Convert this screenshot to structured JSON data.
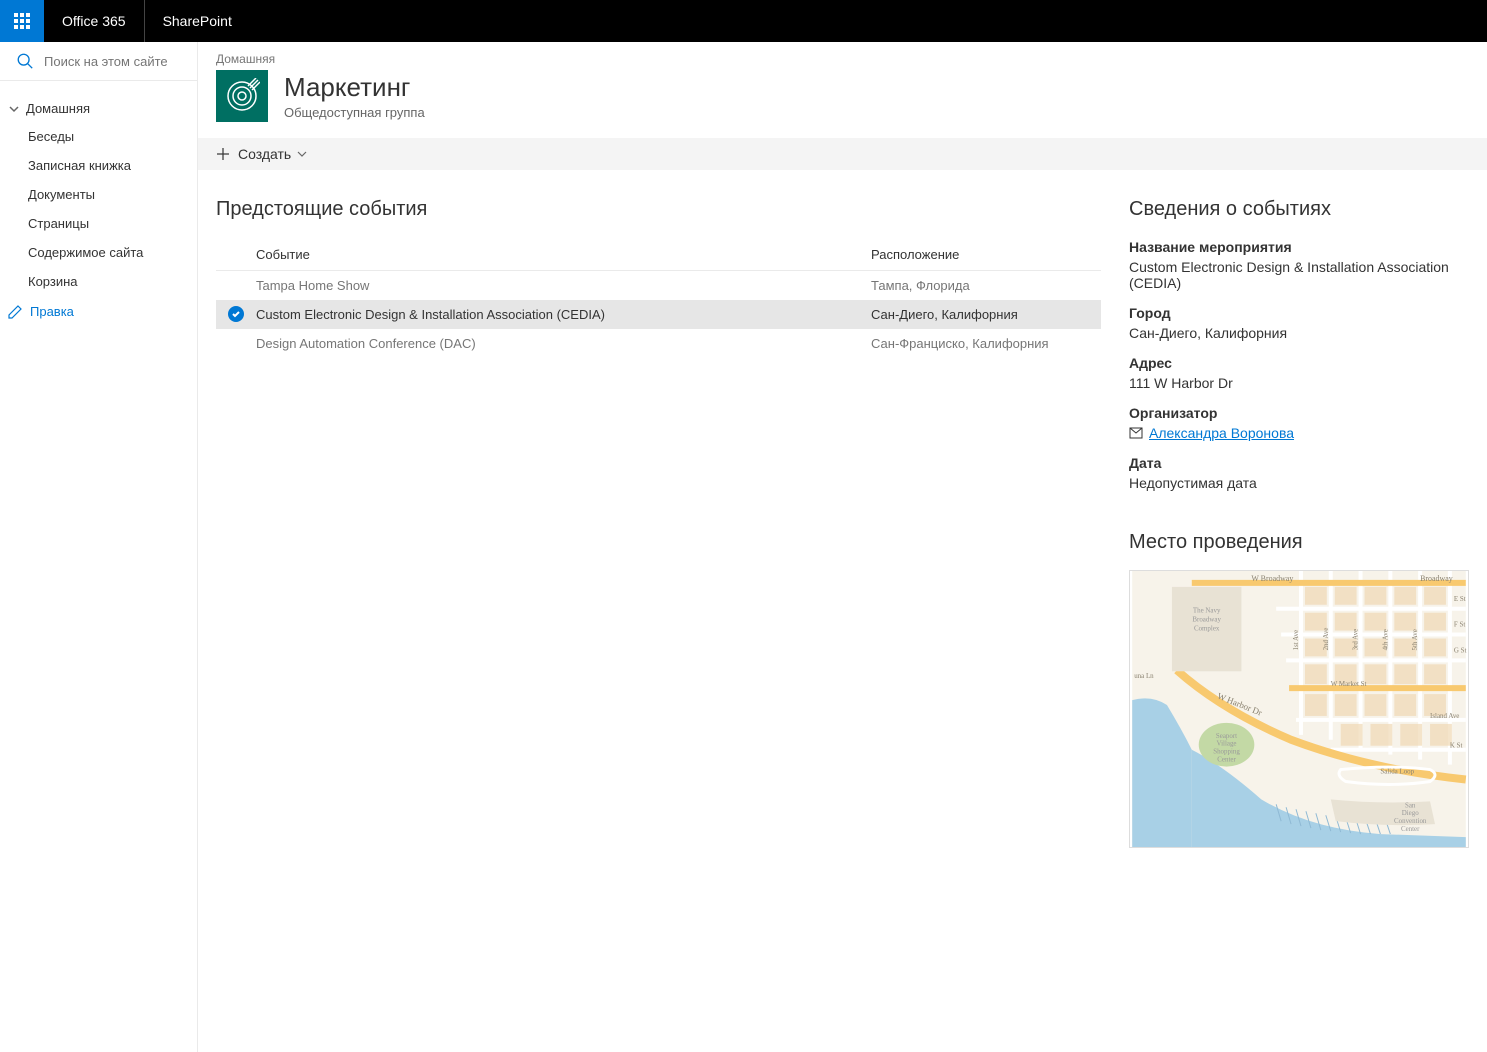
{
  "topbar": {
    "brand": "Office 365",
    "appname": "SharePoint"
  },
  "search": {
    "placeholder": "Поиск на этом сайте"
  },
  "nav": {
    "root": "Домашняя",
    "items": [
      "Беседы",
      "Записная книжка",
      "Документы",
      "Страницы",
      "Содержимое сайта",
      "Корзина"
    ],
    "edit": "Правка"
  },
  "page": {
    "crumb": "Домашняя",
    "title": "Маркетинг",
    "subtitle": "Общедоступная группа"
  },
  "toolbar": {
    "create": "Создать"
  },
  "list": {
    "title": "Предстоящие события",
    "columns": {
      "event": "Событие",
      "location": "Расположение"
    },
    "rows": [
      {
        "event": "Tampa Home Show",
        "location": "Тампа, Флорида",
        "selected": false
      },
      {
        "event": "Custom Electronic Design & Installation Association (CEDIA)",
        "location": "Сан-Диего, Калифорния",
        "selected": true
      },
      {
        "event": "Design Automation Conference (DAC)",
        "location": "Сан-Франциско, Калифорния",
        "selected": false
      }
    ]
  },
  "details": {
    "title": "Сведения о событиях",
    "fields": {
      "name_label": "Название мероприятия",
      "name_value": "Custom Electronic Design & Installation Association (CEDIA)",
      "city_label": "Город",
      "city_value": "Сан-Диего, Калифорния",
      "address_label": "Адрес",
      "address_value": "111 W Harbor Dr",
      "organizer_label": "Организатор",
      "organizer_value": "Александра Воронова",
      "date_label": "Дата",
      "date_value": "Недопустимая дата"
    },
    "venue_title": "Место проведения"
  },
  "map": {
    "labels": [
      "W Broadway",
      "Broadway",
      "E St",
      "F St",
      "G St",
      "W Harbor Dr",
      "W Market St",
      "Island Ave",
      "K St",
      "Salida Loop",
      "1st Ave",
      "2nd Ave",
      "3rd Ave",
      "4th Ave",
      "5th Ave",
      "una Ln",
      "The Navy Broadway Complex",
      "Seaport Village Shopping Center",
      "San Diego Convention Center"
    ]
  }
}
